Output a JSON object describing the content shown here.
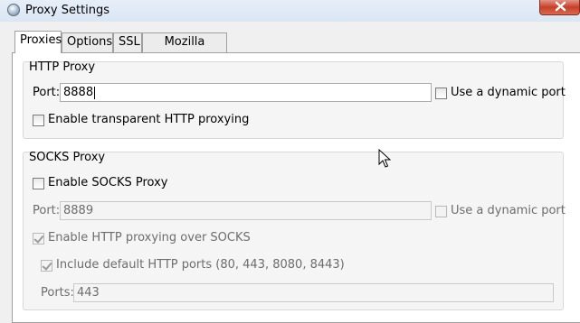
{
  "window": {
    "title": "Proxy Settings"
  },
  "tabs": [
    {
      "label": "Proxies",
      "active": true
    },
    {
      "label": "Options"
    },
    {
      "label": "SSL"
    },
    {
      "label": "Mozilla Firefox"
    }
  ],
  "http_proxy": {
    "group_label": "HTTP Proxy",
    "port_label": "Port:",
    "port_value": "8888",
    "dynamic_port_label": "Use a dynamic port",
    "dynamic_port_checked": false,
    "transparent_label": "Enable transparent HTTP proxying",
    "transparent_checked": false
  },
  "socks_proxy": {
    "group_label": "SOCKS Proxy",
    "enable_label": "Enable SOCKS Proxy",
    "enable_checked": false,
    "port_label": "Port:",
    "port_value": "8889",
    "dynamic_port_label": "Use a dynamic port",
    "dynamic_port_checked": false,
    "http_over_socks_label": "Enable HTTP proxying over SOCKS",
    "http_over_socks_checked": true,
    "include_ports_label": "Include default HTTP ports (80, 443, 8080, 8443)",
    "include_ports_checked": true,
    "ports_label": "Ports:",
    "ports_value": "443"
  },
  "colors": {
    "close_button": "#c7402a",
    "titlebar": "#dbe6f4"
  },
  "icons": {
    "app": "app-icon",
    "close": "close-icon",
    "cursor": "mouse-pointer-icon"
  }
}
